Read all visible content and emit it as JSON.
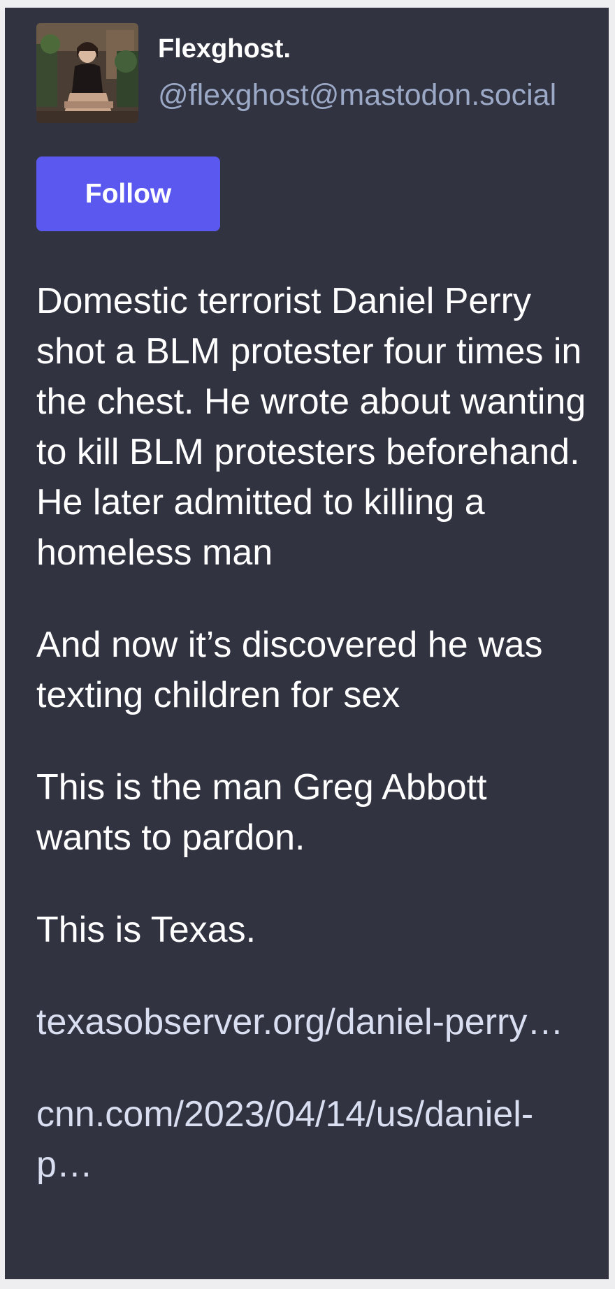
{
  "account": {
    "display_name": "Flexghost.",
    "handle": "@flexghost@mastodon.social",
    "avatar_icon": "profile-photo"
  },
  "actions": {
    "follow_label": "Follow"
  },
  "post": {
    "paragraph_1": "Domestic terrorist Daniel Perry shot a BLM protester four times in the chest. He wrote about wanting to kill BLM protesters beforehand. He later admitted to killing a homeless man",
    "paragraph_2": "And now it’s discovered he was texting children for sex",
    "paragraph_3": "This is the man Greg Abbott wants to pardon.",
    "paragraph_4": "This is Texas.",
    "link_1": "texasobserver.org/daniel-perry…",
    "link_2": "cnn.com/2023/04/14/us/daniel-p…"
  },
  "colors": {
    "card_background": "#313341",
    "accent": "#5b58f0",
    "handle": "#9ba9c6"
  }
}
